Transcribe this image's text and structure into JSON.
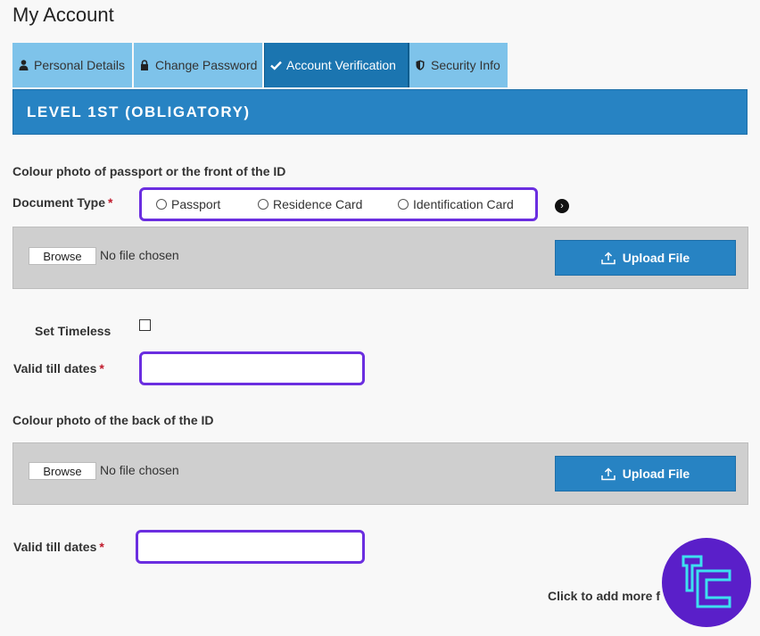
{
  "page": {
    "title": "My Account"
  },
  "tabs": [
    {
      "label": "Personal Details",
      "icon": "user-icon",
      "active": false
    },
    {
      "label": "Change Password",
      "icon": "lock-icon",
      "active": false
    },
    {
      "label": "Account Verification",
      "icon": "check-icon",
      "active": true
    },
    {
      "label": "Security Info",
      "icon": "shield-icon",
      "active": false
    }
  ],
  "level": {
    "title": "LEVEL 1ST (OBLIGATORY)"
  },
  "front": {
    "section_label": "Colour photo of passport or the front of the ID",
    "doc_type_label": "Document Type",
    "required_mark": "*",
    "options": [
      "Passport",
      "Residence Card",
      "Identification Card"
    ],
    "info_glyph": "›",
    "browse_label": "Browse",
    "file_status": "No file chosen",
    "upload_label": "Upload File"
  },
  "timeless": {
    "label": "Set Timeless"
  },
  "valid_till": {
    "label": "Valid till dates",
    "required_mark": "*",
    "value": ""
  },
  "back": {
    "section_label": "Colour photo of the back of the ID",
    "browse_label": "Browse",
    "file_status": "No file chosen",
    "upload_label": "Upload File"
  },
  "valid_till_2": {
    "label": "Valid till dates",
    "required_mark": "*",
    "value": ""
  },
  "more": {
    "label": "Click to add more f"
  },
  "colors": {
    "accent": "#2783c3",
    "active_tab": "#1b75b0",
    "tab": "#7ec3ea",
    "highlight": "#6b2ee0",
    "required": "#c0192b"
  }
}
